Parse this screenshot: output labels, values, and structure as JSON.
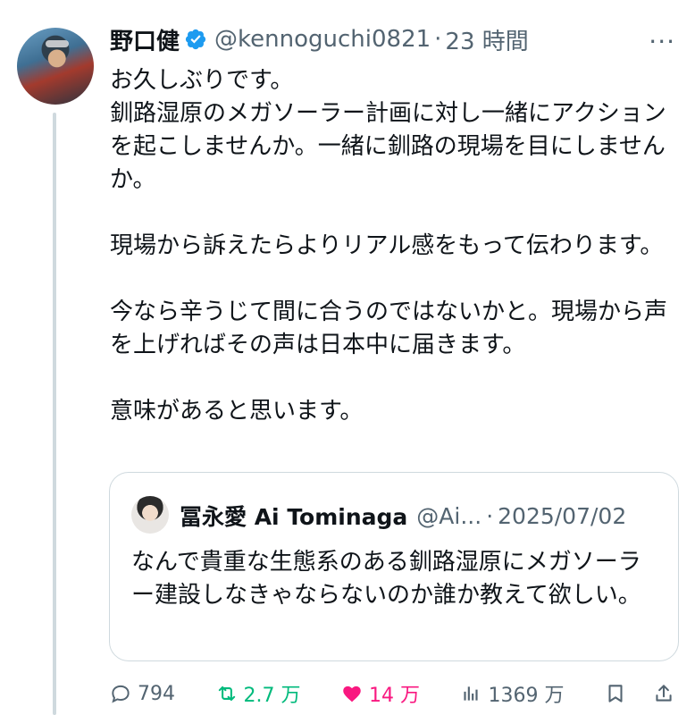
{
  "tweet": {
    "author_name": "野口健",
    "handle": "@kennoguchi0821",
    "separator": "·",
    "time": "23 時間",
    "more_label": "···",
    "paragraphs": [
      "お久しぶりです。\n釧路湿原のメガソーラー計画に対し一緒にアクションを起こしませんか。一緒に釧路の現場を目にしませんか。",
      "現場から訴えたらよりリアル感をもって伝わります。",
      "今なら辛うじて間に合うのではないかと。現場から声を上げればその声は日本中に届きます。",
      "意味があると思います。"
    ]
  },
  "quote": {
    "author_name": "冨永愛 Ai Tominaga",
    "handle": "@Ai...",
    "separator": "·",
    "date": "2025/07/02",
    "text": "なんで貴重な生態系のある釧路湿原にメガソーラー建設しなきゃならないのか誰か教えて欲しい。"
  },
  "actions": {
    "replies": "794",
    "retweets": "2.7 万",
    "likes": "14 万",
    "views": "1369 万"
  },
  "colors": {
    "verified": "#1d9bf0",
    "retweet": "#00ba7c",
    "like": "#f91880",
    "muted": "#536471",
    "border": "#cfd9de"
  },
  "icons": [
    "verified-badge-icon",
    "more-icon",
    "reply-icon",
    "retweet-icon",
    "like-icon",
    "views-icon",
    "bookmark-icon",
    "share-icon"
  ]
}
